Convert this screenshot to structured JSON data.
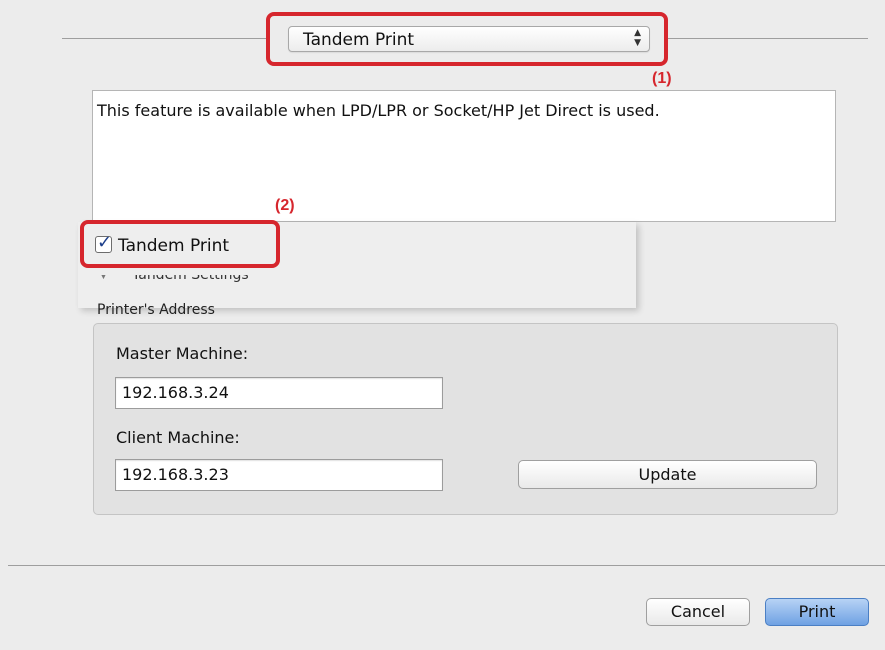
{
  "popup": {
    "selected": "Tandem Print"
  },
  "callouts": {
    "one": "(1)",
    "two": "(2)"
  },
  "description": "This feature is available when LPD/LPR or Socket/HP Jet Direct is used.",
  "tandem": {
    "checkbox_label": "Tandem Print",
    "checked": true,
    "settings_label": "Tandem Settings"
  },
  "address": {
    "title": "Printer's Address",
    "master_label": "Master Machine:",
    "master_value": "192.168.3.24",
    "client_label": "Client Machine:",
    "client_value": "192.168.3.23",
    "update_label": "Update"
  },
  "footer": {
    "cancel_label": "Cancel",
    "print_label": "Print"
  },
  "colors": {
    "highlight": "#d6262d",
    "default_button": "#6fa1e3"
  }
}
